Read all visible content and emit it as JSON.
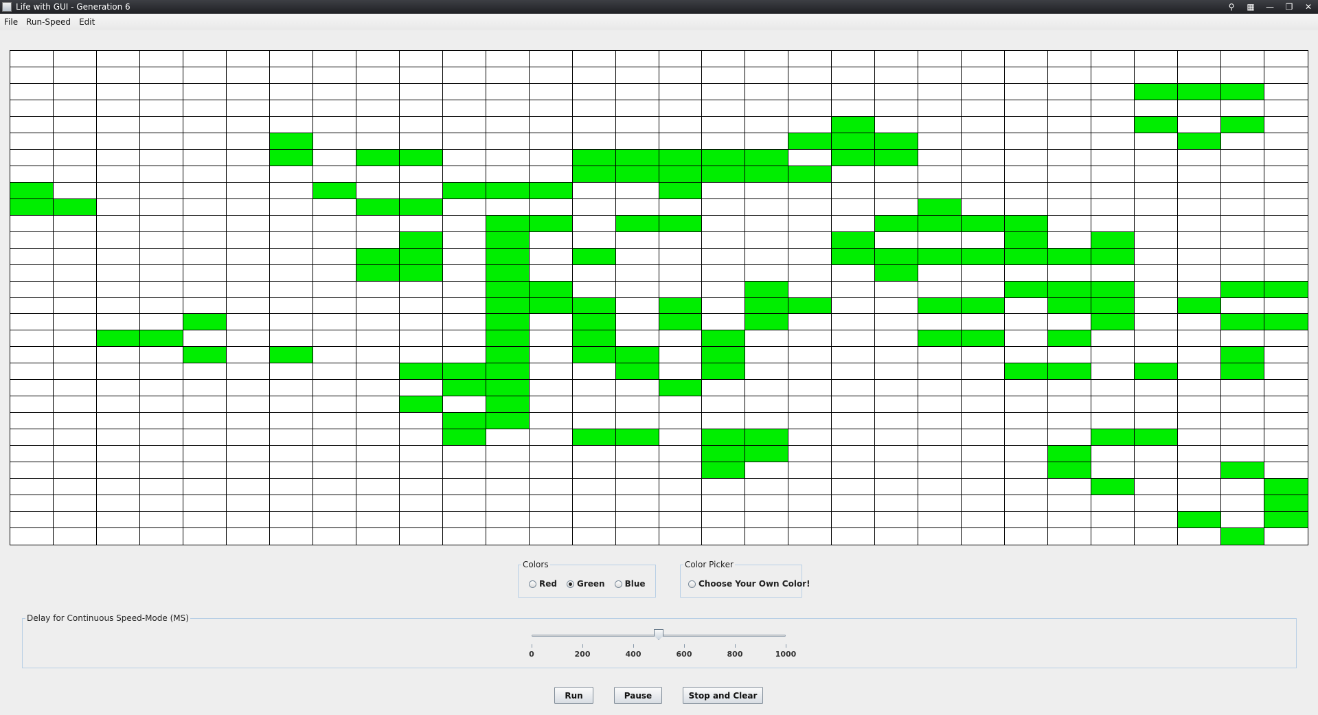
{
  "window": {
    "title": "Life with GUI - Generation 6"
  },
  "menu": [
    "File",
    "Run-Speed",
    "Edit"
  ],
  "grid": {
    "rows": 30,
    "cols": 30,
    "alive_color": "#00ee00",
    "dead_color": "#ffffff",
    "alive": [
      [
        2,
        26
      ],
      [
        2,
        27
      ],
      [
        2,
        28
      ],
      [
        4,
        19
      ],
      [
        4,
        26
      ],
      [
        4,
        28
      ],
      [
        5,
        6
      ],
      [
        5,
        18
      ],
      [
        5,
        19
      ],
      [
        5,
        20
      ],
      [
        5,
        27
      ],
      [
        6,
        6
      ],
      [
        6,
        8
      ],
      [
        6,
        9
      ],
      [
        6,
        13
      ],
      [
        6,
        14
      ],
      [
        6,
        15
      ],
      [
        6,
        16
      ],
      [
        6,
        17
      ],
      [
        6,
        19
      ],
      [
        6,
        20
      ],
      [
        7,
        13
      ],
      [
        7,
        14
      ],
      [
        7,
        15
      ],
      [
        7,
        16
      ],
      [
        7,
        17
      ],
      [
        7,
        18
      ],
      [
        8,
        0
      ],
      [
        8,
        7
      ],
      [
        8,
        10
      ],
      [
        8,
        11
      ],
      [
        8,
        12
      ],
      [
        8,
        15
      ],
      [
        9,
        0
      ],
      [
        9,
        1
      ],
      [
        9,
        8
      ],
      [
        9,
        9
      ],
      [
        9,
        21
      ],
      [
        10,
        11
      ],
      [
        10,
        12
      ],
      [
        10,
        14
      ],
      [
        10,
        15
      ],
      [
        10,
        20
      ],
      [
        10,
        21
      ],
      [
        10,
        22
      ],
      [
        10,
        23
      ],
      [
        11,
        9
      ],
      [
        11,
        11
      ],
      [
        11,
        19
      ],
      [
        11,
        23
      ],
      [
        11,
        25
      ],
      [
        12,
        8
      ],
      [
        12,
        9
      ],
      [
        12,
        11
      ],
      [
        12,
        13
      ],
      [
        12,
        19
      ],
      [
        12,
        20
      ],
      [
        12,
        21
      ],
      [
        12,
        22
      ],
      [
        12,
        23
      ],
      [
        12,
        24
      ],
      [
        12,
        25
      ],
      [
        13,
        8
      ],
      [
        13,
        9
      ],
      [
        13,
        11
      ],
      [
        13,
        20
      ],
      [
        14,
        11
      ],
      [
        14,
        12
      ],
      [
        14,
        17
      ],
      [
        14,
        23
      ],
      [
        14,
        24
      ],
      [
        14,
        25
      ],
      [
        14,
        28
      ],
      [
        14,
        29
      ],
      [
        15,
        11
      ],
      [
        15,
        12
      ],
      [
        15,
        13
      ],
      [
        15,
        15
      ],
      [
        15,
        17
      ],
      [
        15,
        18
      ],
      [
        15,
        21
      ],
      [
        15,
        22
      ],
      [
        15,
        24
      ],
      [
        15,
        25
      ],
      [
        15,
        27
      ],
      [
        16,
        4
      ],
      [
        16,
        11
      ],
      [
        16,
        13
      ],
      [
        16,
        15
      ],
      [
        16,
        17
      ],
      [
        16,
        25
      ],
      [
        16,
        28
      ],
      [
        16,
        29
      ],
      [
        17,
        2
      ],
      [
        17,
        3
      ],
      [
        17,
        11
      ],
      [
        17,
        13
      ],
      [
        17,
        16
      ],
      [
        17,
        21
      ],
      [
        17,
        22
      ],
      [
        17,
        24
      ],
      [
        18,
        4
      ],
      [
        18,
        6
      ],
      [
        18,
        11
      ],
      [
        18,
        13
      ],
      [
        18,
        14
      ],
      [
        18,
        16
      ],
      [
        18,
        28
      ],
      [
        19,
        9
      ],
      [
        19,
        10
      ],
      [
        19,
        11
      ],
      [
        19,
        14
      ],
      [
        19,
        16
      ],
      [
        19,
        23
      ],
      [
        19,
        24
      ],
      [
        19,
        26
      ],
      [
        19,
        28
      ],
      [
        20,
        10
      ],
      [
        20,
        11
      ],
      [
        20,
        15
      ],
      [
        21,
        9
      ],
      [
        21,
        11
      ],
      [
        22,
        10
      ],
      [
        22,
        11
      ],
      [
        23,
        10
      ],
      [
        23,
        13
      ],
      [
        23,
        14
      ],
      [
        23,
        16
      ],
      [
        23,
        17
      ],
      [
        23,
        25
      ],
      [
        23,
        26
      ],
      [
        24,
        16
      ],
      [
        24,
        17
      ],
      [
        24,
        24
      ],
      [
        25,
        16
      ],
      [
        25,
        24
      ],
      [
        25,
        28
      ],
      [
        26,
        25
      ],
      [
        26,
        29
      ],
      [
        27,
        29
      ],
      [
        28,
        27
      ],
      [
        28,
        29
      ],
      [
        29,
        28
      ]
    ]
  },
  "colors_group": {
    "title": "Colors",
    "options": [
      {
        "label": "Red",
        "selected": false
      },
      {
        "label": "Green",
        "selected": true
      },
      {
        "label": "Blue",
        "selected": false
      }
    ]
  },
  "color_picker_group": {
    "title": "Color Picker",
    "option": {
      "label": "Choose Your Own Color!",
      "selected": false
    }
  },
  "delay_group": {
    "title": "Delay for Continuous Speed-Mode (MS)",
    "slider": {
      "min": 0,
      "max": 1000,
      "value": 500,
      "tick_labels": [
        "0",
        "200",
        "400",
        "600",
        "800",
        "1000"
      ]
    }
  },
  "buttons": {
    "run": "Run",
    "pause": "Pause",
    "stop_clear": "Stop and Clear"
  }
}
